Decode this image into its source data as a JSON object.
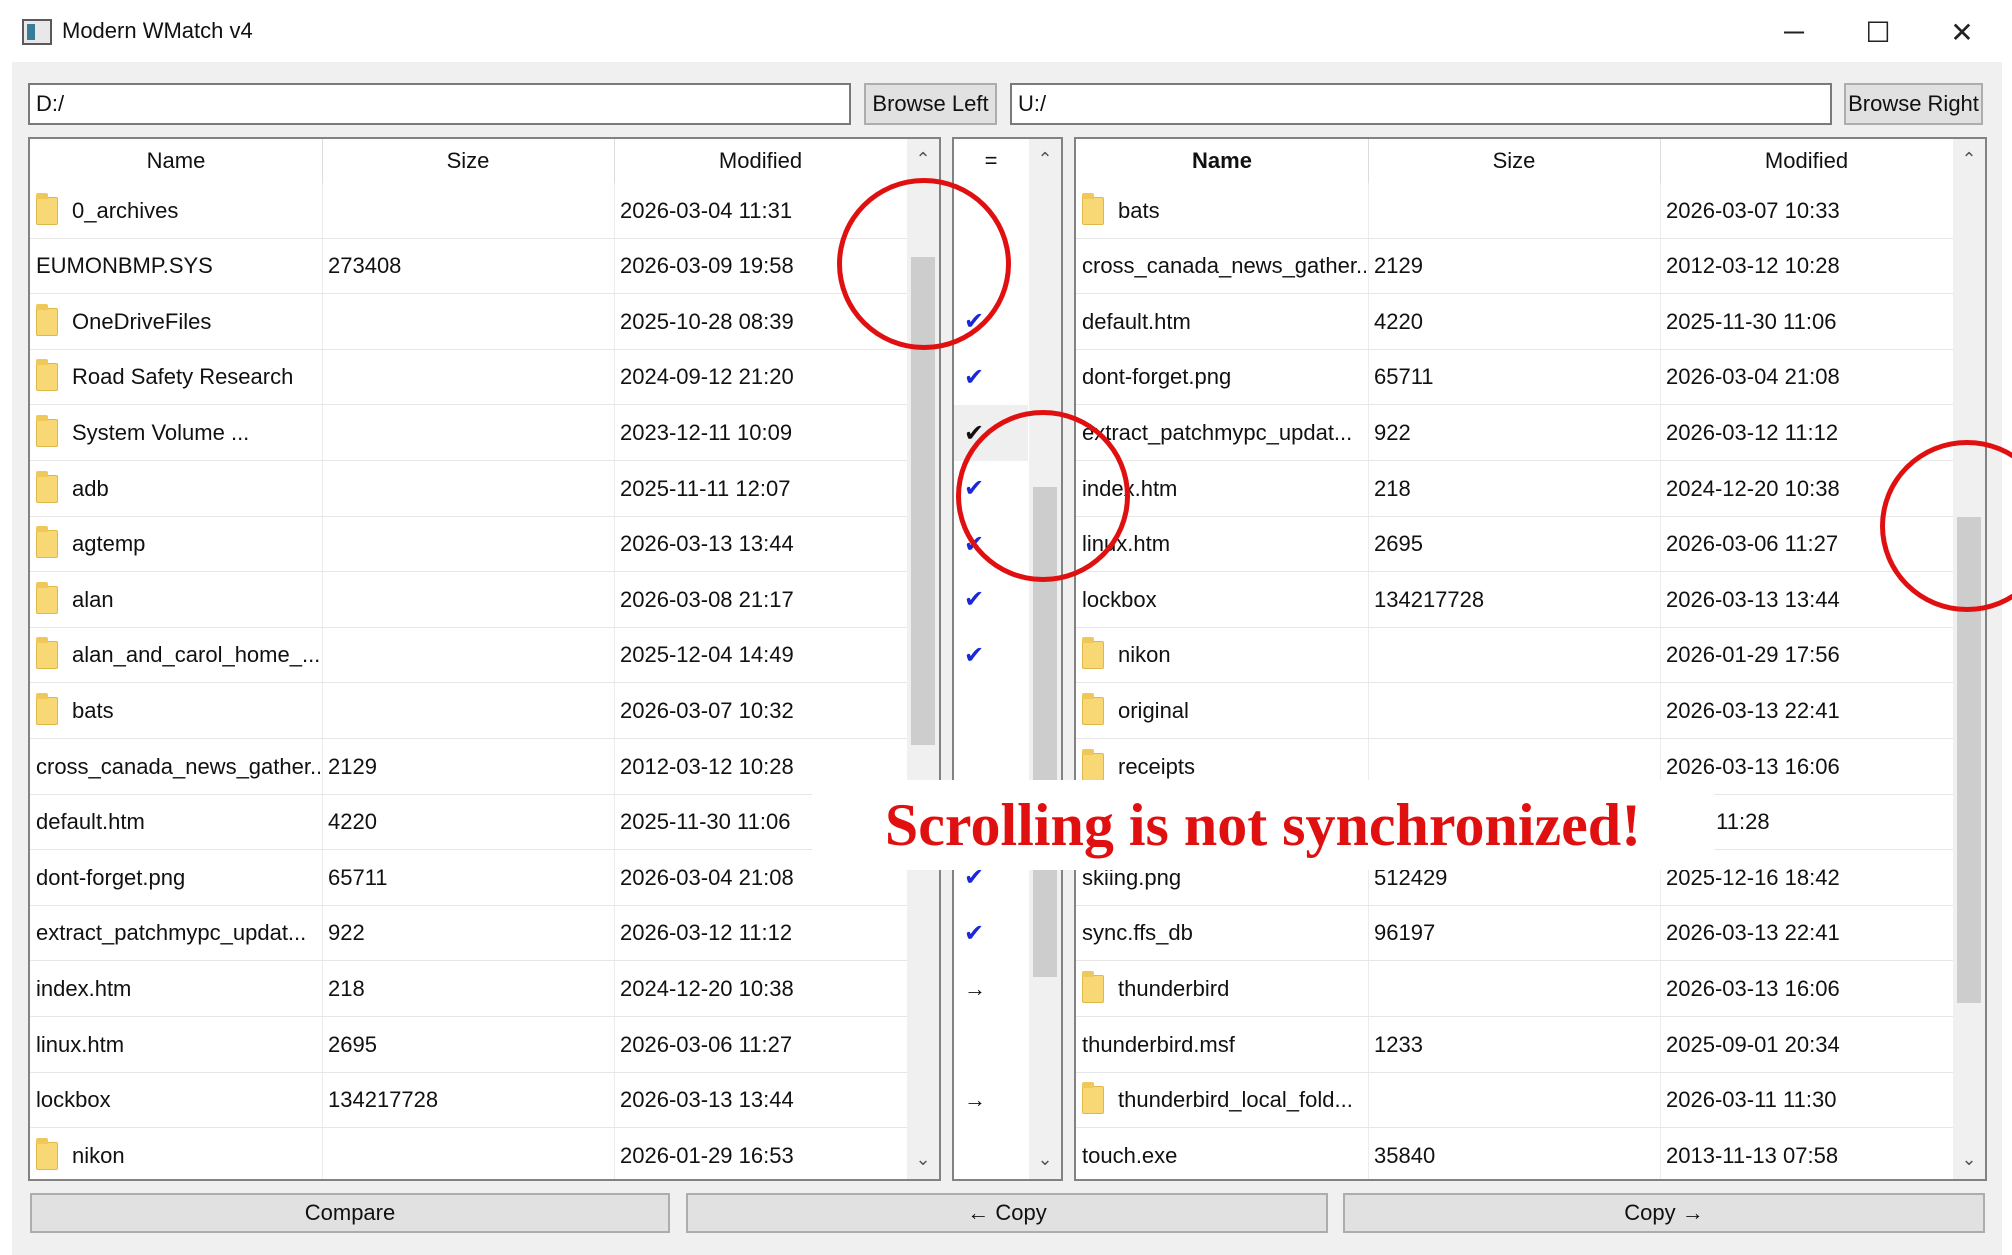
{
  "window": {
    "title": "Modern WMatch v4",
    "minimize_glyph": "─",
    "maximize_glyph": "☐",
    "close_glyph": "✕"
  },
  "toolbar": {
    "left_path": "D:/",
    "right_path": "U:/",
    "browse_left_label": "Browse Left",
    "browse_right_label": "Browse Right"
  },
  "left_panel": {
    "columns": [
      "Name",
      "Size",
      "Modified"
    ],
    "rows": [
      {
        "name": "0_archives",
        "size": "",
        "modified": "2026-03-04 11:31",
        "is_folder": true
      },
      {
        "name": "EUMONBMP.SYS",
        "size": "273408",
        "modified": "2026-03-09 19:58",
        "is_folder": false
      },
      {
        "name": "OneDriveFiles",
        "size": "",
        "modified": "2025-10-28 08:39",
        "is_folder": true
      },
      {
        "name": "Road Safety Research",
        "size": "",
        "modified": "2024-09-12 21:20",
        "is_folder": true
      },
      {
        "name": "System Volume ...",
        "size": "",
        "modified": "2023-12-11 10:09",
        "is_folder": true
      },
      {
        "name": "adb",
        "size": "",
        "modified": "2025-11-11 12:07",
        "is_folder": true
      },
      {
        "name": "agtemp",
        "size": "",
        "modified": "2026-03-13 13:44",
        "is_folder": true
      },
      {
        "name": "alan",
        "size": "",
        "modified": "2026-03-08 21:17",
        "is_folder": true
      },
      {
        "name": "alan_and_carol_home_...",
        "size": "",
        "modified": "2025-12-04 14:49",
        "is_folder": true
      },
      {
        "name": "bats",
        "size": "",
        "modified": "2026-03-07 10:32",
        "is_folder": true
      },
      {
        "name": "cross_canada_news_gather...",
        "size": "2129",
        "modified": "2012-03-12 10:28",
        "is_folder": false
      },
      {
        "name": "default.htm",
        "size": "4220",
        "modified": "2025-11-30 11:06",
        "is_folder": false
      },
      {
        "name": "dont-forget.png",
        "size": "65711",
        "modified": "2026-03-04 21:08",
        "is_folder": false
      },
      {
        "name": "extract_patchmypc_updat...",
        "size": "922",
        "modified": "2026-03-12 11:12",
        "is_folder": false
      },
      {
        "name": "index.htm",
        "size": "218",
        "modified": "2024-12-20 10:38",
        "is_folder": false
      },
      {
        "name": "linux.htm",
        "size": "2695",
        "modified": "2026-03-06 11:27",
        "is_folder": false
      },
      {
        "name": "lockbox",
        "size": "134217728",
        "modified": "2026-03-13 13:44",
        "is_folder": false
      },
      {
        "name": "nikon",
        "size": "",
        "modified": "2026-01-29 16:53",
        "is_folder": true
      }
    ]
  },
  "middle_panel": {
    "header": "=",
    "marks": [
      {
        "symbol": "",
        "kind": "none"
      },
      {
        "symbol": "",
        "kind": "none"
      },
      {
        "symbol": "✔",
        "kind": "check"
      },
      {
        "symbol": "✔",
        "kind": "check"
      },
      {
        "symbol": "✔",
        "kind": "dark"
      },
      {
        "symbol": "✔",
        "kind": "check"
      },
      {
        "symbol": "✔",
        "kind": "check"
      },
      {
        "symbol": "✔",
        "kind": "check"
      },
      {
        "symbol": "✔",
        "kind": "check"
      },
      {
        "symbol": "",
        "kind": "none"
      },
      {
        "symbol": "",
        "kind": "none"
      },
      {
        "symbol": "",
        "kind": "none"
      },
      {
        "symbol": "✔",
        "kind": "check"
      },
      {
        "symbol": "✔",
        "kind": "check"
      },
      {
        "symbol": "→",
        "kind": "arrow"
      },
      {
        "symbol": "",
        "kind": "none"
      },
      {
        "symbol": "→",
        "kind": "arrow"
      },
      {
        "symbol": "",
        "kind": "none"
      }
    ]
  },
  "right_panel": {
    "columns": [
      "Name",
      "Size",
      "Modified"
    ],
    "rows": [
      {
        "name": "bats",
        "size": "",
        "modified": "2026-03-07 10:33",
        "is_folder": true
      },
      {
        "name": "cross_canada_news_gather...",
        "size": "2129",
        "modified": "2012-03-12 10:28",
        "is_folder": false
      },
      {
        "name": "default.htm",
        "size": "4220",
        "modified": "2025-11-30 11:06",
        "is_folder": false
      },
      {
        "name": "dont-forget.png",
        "size": "65711",
        "modified": "2026-03-04 21:08",
        "is_folder": false
      },
      {
        "name": "extract_patchmypc_updat...",
        "size": "922",
        "modified": "2026-03-12 11:12",
        "is_folder": false
      },
      {
        "name": "index.htm",
        "size": "218",
        "modified": "2024-12-20 10:38",
        "is_folder": false
      },
      {
        "name": "linux.htm",
        "size": "2695",
        "modified": "2026-03-06 11:27",
        "is_folder": false
      },
      {
        "name": "lockbox",
        "size": "134217728",
        "modified": "2026-03-13 13:44",
        "is_folder": false
      },
      {
        "name": "nikon",
        "size": "",
        "modified": "2026-01-29 17:56",
        "is_folder": true
      },
      {
        "name": "original",
        "size": "",
        "modified": "2026-03-13 22:41",
        "is_folder": true
      },
      {
        "name": "receipts",
        "size": "",
        "modified": "2026-03-13 16:06",
        "is_folder": true
      },
      {
        "name": "",
        "size": "",
        "modified": "3-06 11:28",
        "is_folder": false
      },
      {
        "name": "skiing.png",
        "size": "512429",
        "modified": "2025-12-16 18:42",
        "is_folder": false
      },
      {
        "name": "sync.ffs_db",
        "size": "96197",
        "modified": "2026-03-13 22:41",
        "is_folder": false
      },
      {
        "name": "thunderbird",
        "size": "",
        "modified": "2026-03-13 16:06",
        "is_folder": true
      },
      {
        "name": "thunderbird.msf",
        "size": "1233",
        "modified": "2025-09-01 20:34",
        "is_folder": false
      },
      {
        "name": "thunderbird_local_fold...",
        "size": "",
        "modified": "2026-03-11 11:30",
        "is_folder": true
      },
      {
        "name": "touch.exe",
        "size": "35840",
        "modified": "2013-11-13 07:58",
        "is_folder": false
      }
    ]
  },
  "scrollbars": {
    "up_glyph": "⌃",
    "down_glyph": "⌄"
  },
  "bottom": {
    "compare_label": "Compare",
    "copy_left_label": "← Copy",
    "copy_right_label": "Copy →"
  },
  "annotation": {
    "text": "Scrolling is not synchronized!",
    "color": "#e01010"
  }
}
